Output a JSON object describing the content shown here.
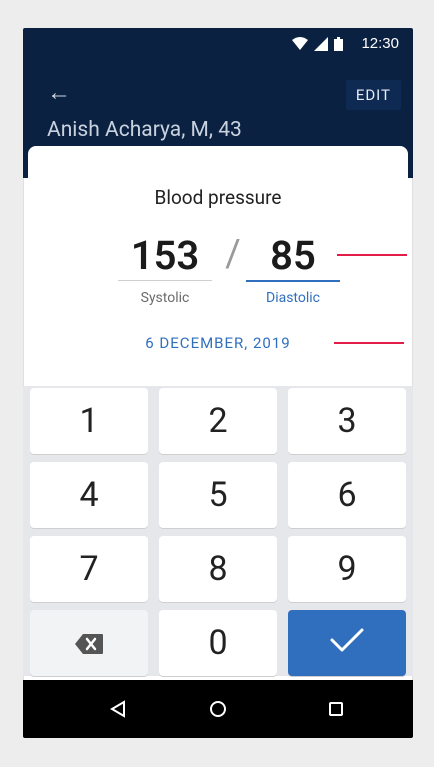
{
  "status": {
    "time": "12:30"
  },
  "appbar": {
    "patient": "Anish Acharya, M, 43",
    "edit_label": "EDIT"
  },
  "sheet": {
    "title": "Blood pressure",
    "systolic": "153",
    "diastolic": "85",
    "systolic_label": "Systolic",
    "diastolic_label": "Diastolic",
    "date": "6 DECEMBER, 2019"
  },
  "keypad": {
    "k1": "1",
    "k2": "2",
    "k3": "3",
    "k4": "4",
    "k5": "5",
    "k6": "6",
    "k7": "7",
    "k8": "8",
    "k9": "9",
    "k0": "0"
  },
  "colors": {
    "primary": "#2f6fbe",
    "appbar": "#0b2141",
    "annotation": "#e11d48"
  }
}
